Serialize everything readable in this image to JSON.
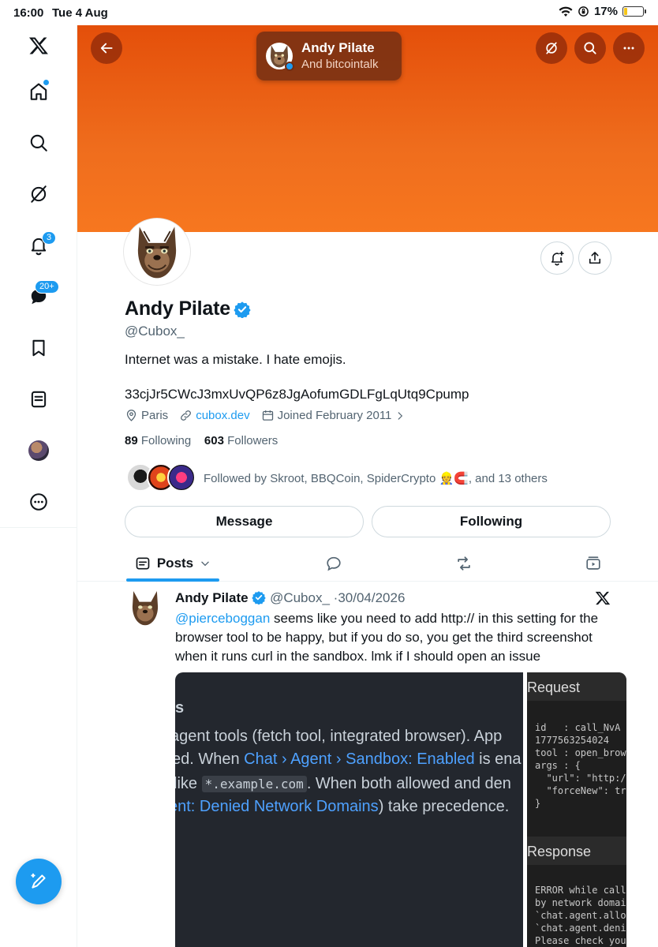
{
  "status_bar": {
    "time": "16:00",
    "date": "Tue 4 Aug",
    "battery": "17%"
  },
  "nav": {
    "notifications_badge": "3",
    "messages_badge": "20+"
  },
  "header": {
    "name": "Andy Pilate",
    "subtitle": "And bitcointalk"
  },
  "profile": {
    "display_name": "Andy Pilate",
    "handle": "@Cubox_",
    "bio": "Internet was a mistake. I hate emojis.",
    "bio_line2": "33cjJr5CWcJ3mxUvQP6z8JgAofumGDLFgLqUtq9Cpump",
    "location": "Paris",
    "website": "cubox.dev",
    "joined": "Joined February 2011",
    "following_count": "89",
    "following_label": "Following",
    "followers_count": "603",
    "followers_label": "Followers",
    "followed_by": "Followed by Skroot, BBQCoin, SpiderCrypto 👷🧲, and 13 others",
    "message_button": "Message",
    "following_button": "Following"
  },
  "tabs": {
    "posts_label": "Posts"
  },
  "post": {
    "author": "Andy Pilate",
    "handle": "@Cubox_",
    "separator": "·",
    "date": "30/04/2026",
    "mention": "@pierceboggan",
    "text": " seems like you need to add http:// in this setting for the browser tool to be happy, but if you do so, you get the third screenshot when it runs curl in the sandbox. lmk if I should open an issue",
    "shot1": {
      "heading": "s",
      "line1": "agent tools (fetch tool, integrated browser). App",
      "line2_a": "ed. When ",
      "line2_link": "Chat › Agent › Sandbox: Enabled",
      "line2_b": " is ena",
      "line3_a": " like ",
      "line3_code": "*.example.com",
      "line3_b": ". When both allowed and den",
      "line4_link": "ent: Denied Network Domains",
      "line4_b": ") take precedence."
    },
    "shot2": {
      "request_header": "Request",
      "request_body": "id   : call_NvA\n1777563254024\ntool : open_brow\nargs : {\n  \"url\": \"http:/\n  \"forceNew\": tr\n}",
      "response_header": "Response",
      "response_body": "ERROR while call\nby network domai\n`chat.agent.allo\n`chat.agent.deni\nPlease check you"
    }
  },
  "colors": {
    "accent": "#1d9bf0",
    "banner": "#ef6d1d"
  }
}
